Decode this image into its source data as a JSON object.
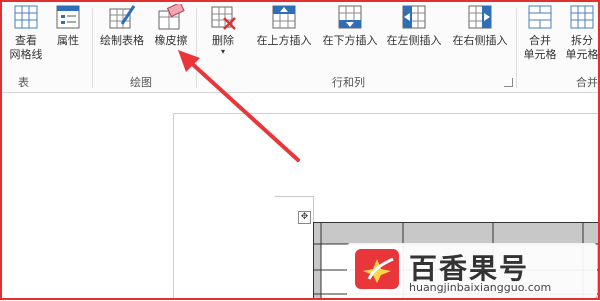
{
  "ribbon": {
    "groups": {
      "table": "表",
      "draw": "绘图",
      "rows_cols": "行和列",
      "merge": "合并"
    },
    "buttons": {
      "view_gridlines": [
        "查看",
        "网格线"
      ],
      "properties": "属性",
      "draw_table": "绘制表格",
      "eraser": "橡皮擦",
      "delete": "删除",
      "insert_above": "在上方插入",
      "insert_below": "在下方插入",
      "insert_left": "在左侧插入",
      "insert_right": "在右侧插入",
      "merge_cells": [
        "合并",
        "单元格"
      ],
      "split_cells": [
        "拆分",
        "单元格"
      ]
    }
  },
  "watermark": {
    "title": "百香果号",
    "url": "huangjinbaixiangguo.com"
  },
  "colors": {
    "highlight_border": "#e03030",
    "arrow": "#e8363b",
    "table_shade": "#c8c8c8",
    "icon_blue": "#2f6fb8"
  }
}
